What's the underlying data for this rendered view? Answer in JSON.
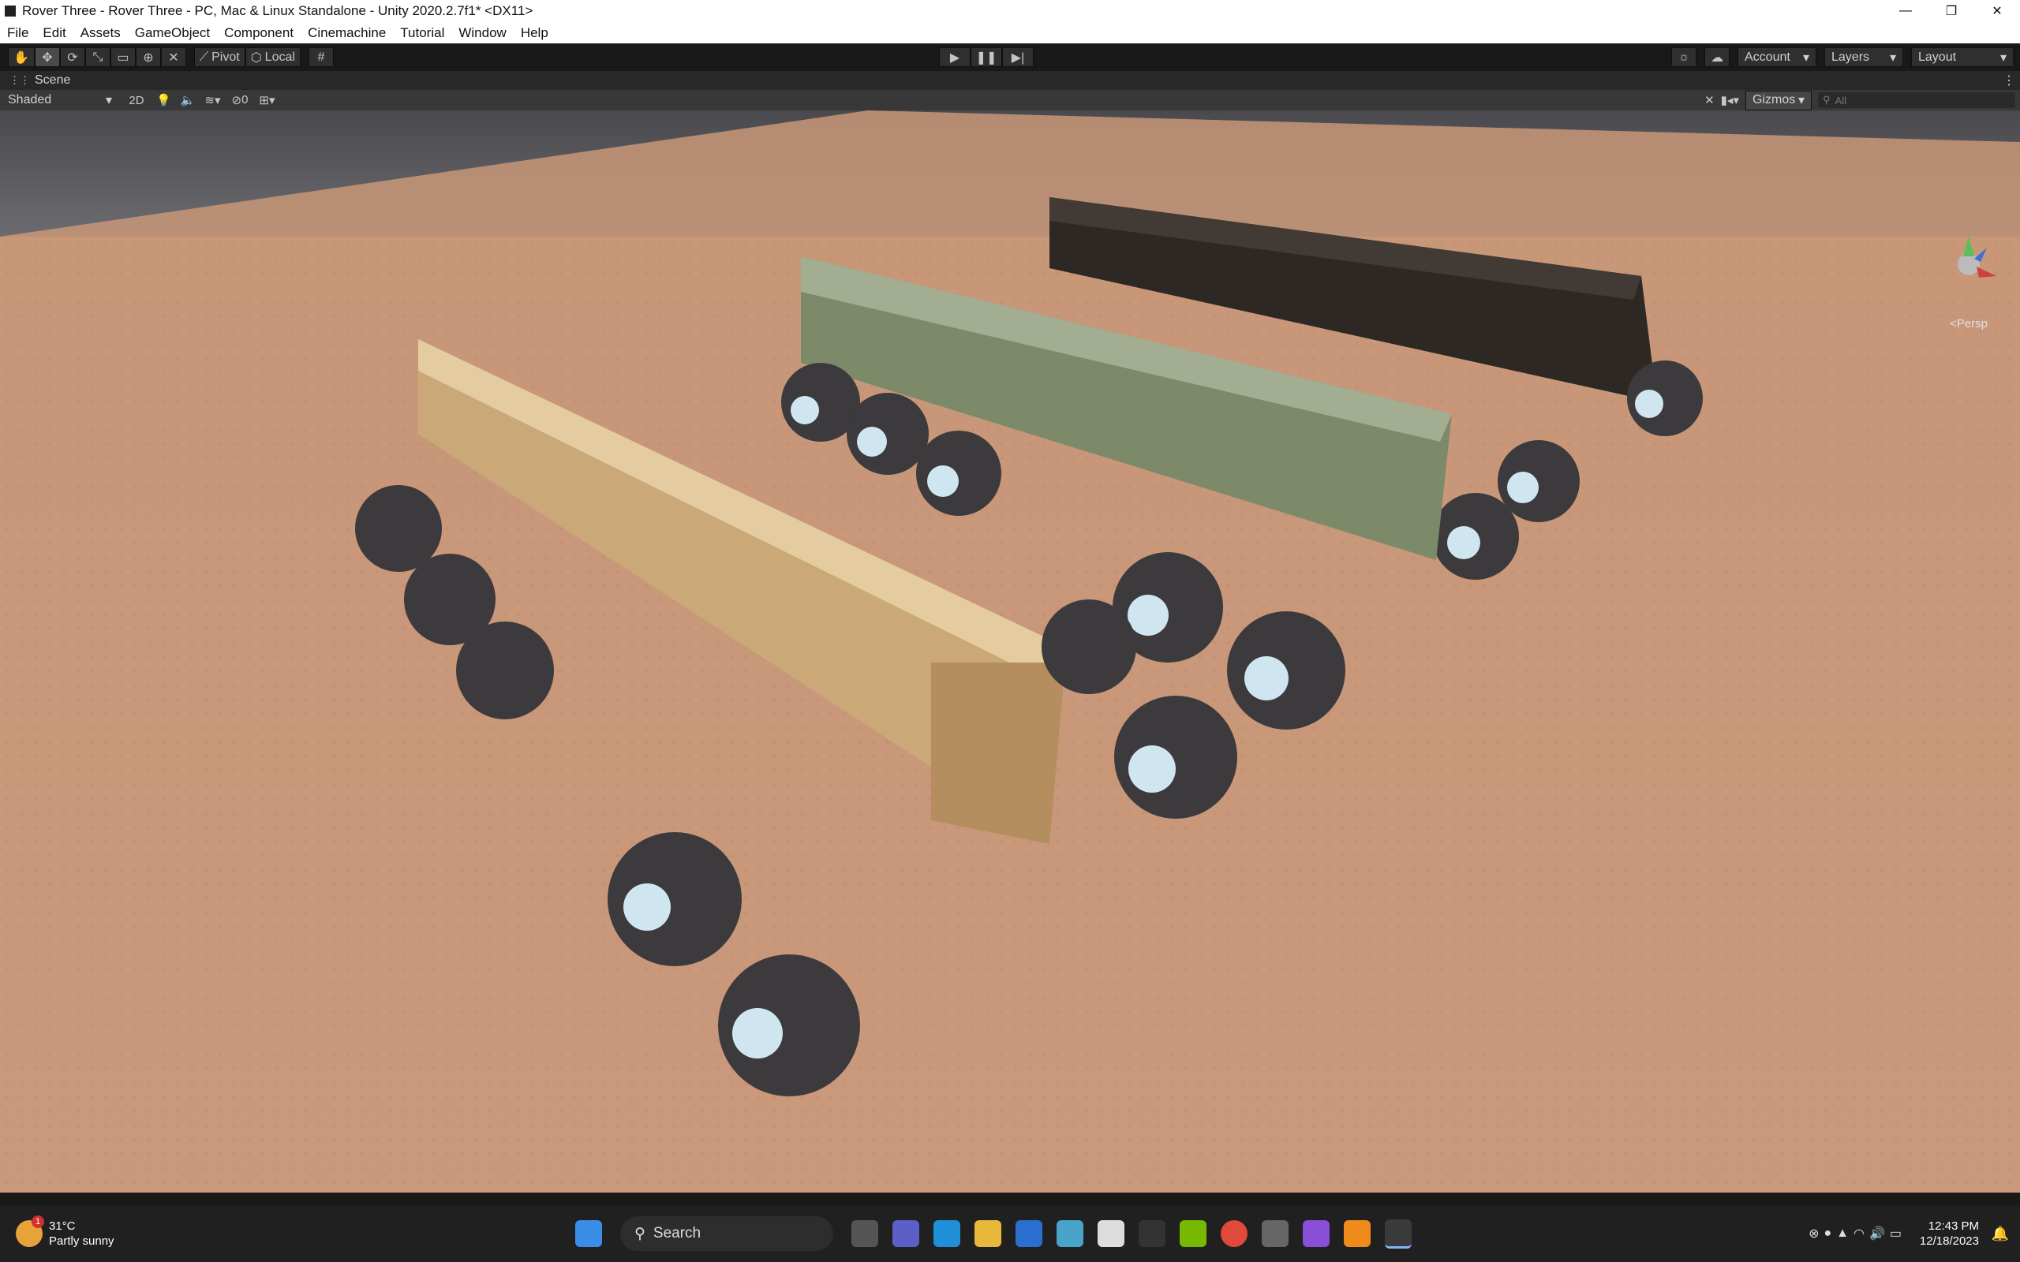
{
  "window": {
    "title": "Rover Three - Rover Three - PC, Mac & Linux Standalone - Unity 2020.2.7f1* <DX11>",
    "controls": [
      "—",
      "❐",
      "✕"
    ]
  },
  "menu": [
    "File",
    "Edit",
    "Assets",
    "GameObject",
    "Component",
    "Cinemachine",
    "Tutorial",
    "Window",
    "Help"
  ],
  "toolbar": {
    "pivot_label": "Pivot",
    "local_label": "Local",
    "account_label": "Account",
    "layers_label": "Layers",
    "layout_label": "Layout"
  },
  "scene": {
    "tab_label": "Scene",
    "shading_mode": "Shaded",
    "mode_2d": "2D",
    "hidden_count": "0",
    "gizmos_label": "Gizmos",
    "search_placeholder": "All",
    "projection_label": "Persp",
    "axis_labels": {
      "y": "y",
      "x": "x",
      "z": "z"
    }
  },
  "taskbar": {
    "weather_temp": "31°C",
    "weather_desc": "Partly sunny",
    "weather_badge": "1",
    "search_label": "Search",
    "time": "12:43 PM",
    "date": "12/18/2023"
  }
}
